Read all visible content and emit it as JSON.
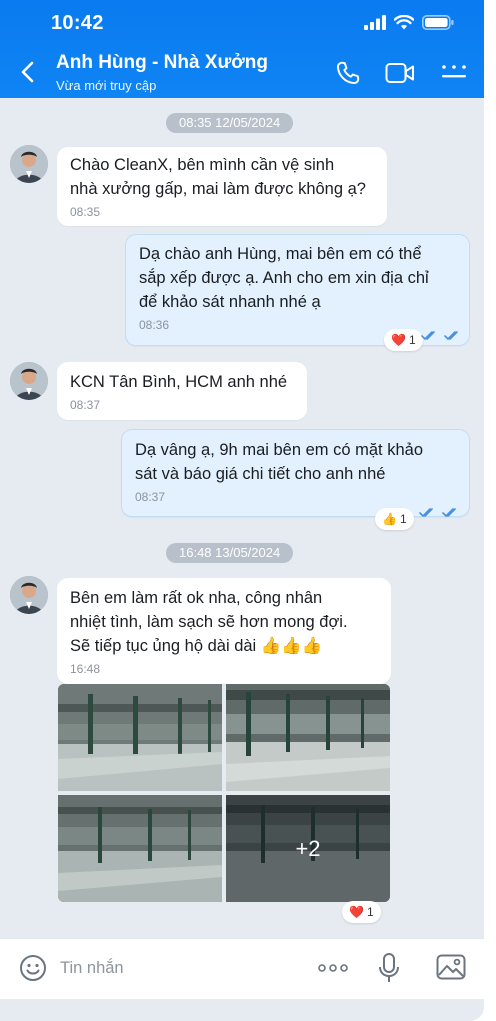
{
  "status_bar": {
    "time": "10:42"
  },
  "header": {
    "title": "Anh Hùng - Nhà Xưởng",
    "subtitle": "Vừa mới truy cập"
  },
  "messages": {
    "date1": "08:35 12/05/2024",
    "m1": {
      "text": "Chào CleanX, bên mình cần vệ sinh\nnhà xưởng gấp, mai làm được không ạ?",
      "time": "08:35"
    },
    "m2": {
      "text": "Dạ chào anh Hùng, mai bên em có thể\nsắp xếp được ạ. Anh cho em xin địa chỉ\nđể khảo sát nhanh nhé ạ",
      "time": "08:36",
      "reaction_emoji": "❤️",
      "reaction_count": "1"
    },
    "m3": {
      "text": "KCN Tân Bình, HCM anh nhé",
      "time": "08:37"
    },
    "m4": {
      "text": "Dạ vâng ạ, 9h mai bên em có mặt khảo\nsát và báo giá chi tiết cho anh nhé",
      "time": "08:37",
      "reaction_emoji": "👍",
      "reaction_count": "1"
    },
    "date2": "16:48 13/05/2024",
    "m5": {
      "text": "Bên em làm rất ok nha, công nhân\nnhiệt tình, làm sạch sẽ hơn mong đợi.\nSẽ tiếp tục ủng hộ dài dài 👍👍👍",
      "time": "16:48"
    },
    "photos": {
      "more_label": "+2",
      "reaction_emoji": "❤️",
      "reaction_count": "1"
    }
  },
  "input": {
    "placeholder": "Tin nhắn"
  },
  "icons": [
    "back-arrow-icon",
    "phone-icon",
    "video-call-icon",
    "menu-icon",
    "emoji-icon",
    "more-icon",
    "microphone-icon",
    "image-icon"
  ],
  "colors": {
    "header": "#0a7bf0",
    "outgoing_bubble": "#e2f1fd",
    "chat_bg": "#e6ebf1",
    "tick": "#4a90e2"
  }
}
